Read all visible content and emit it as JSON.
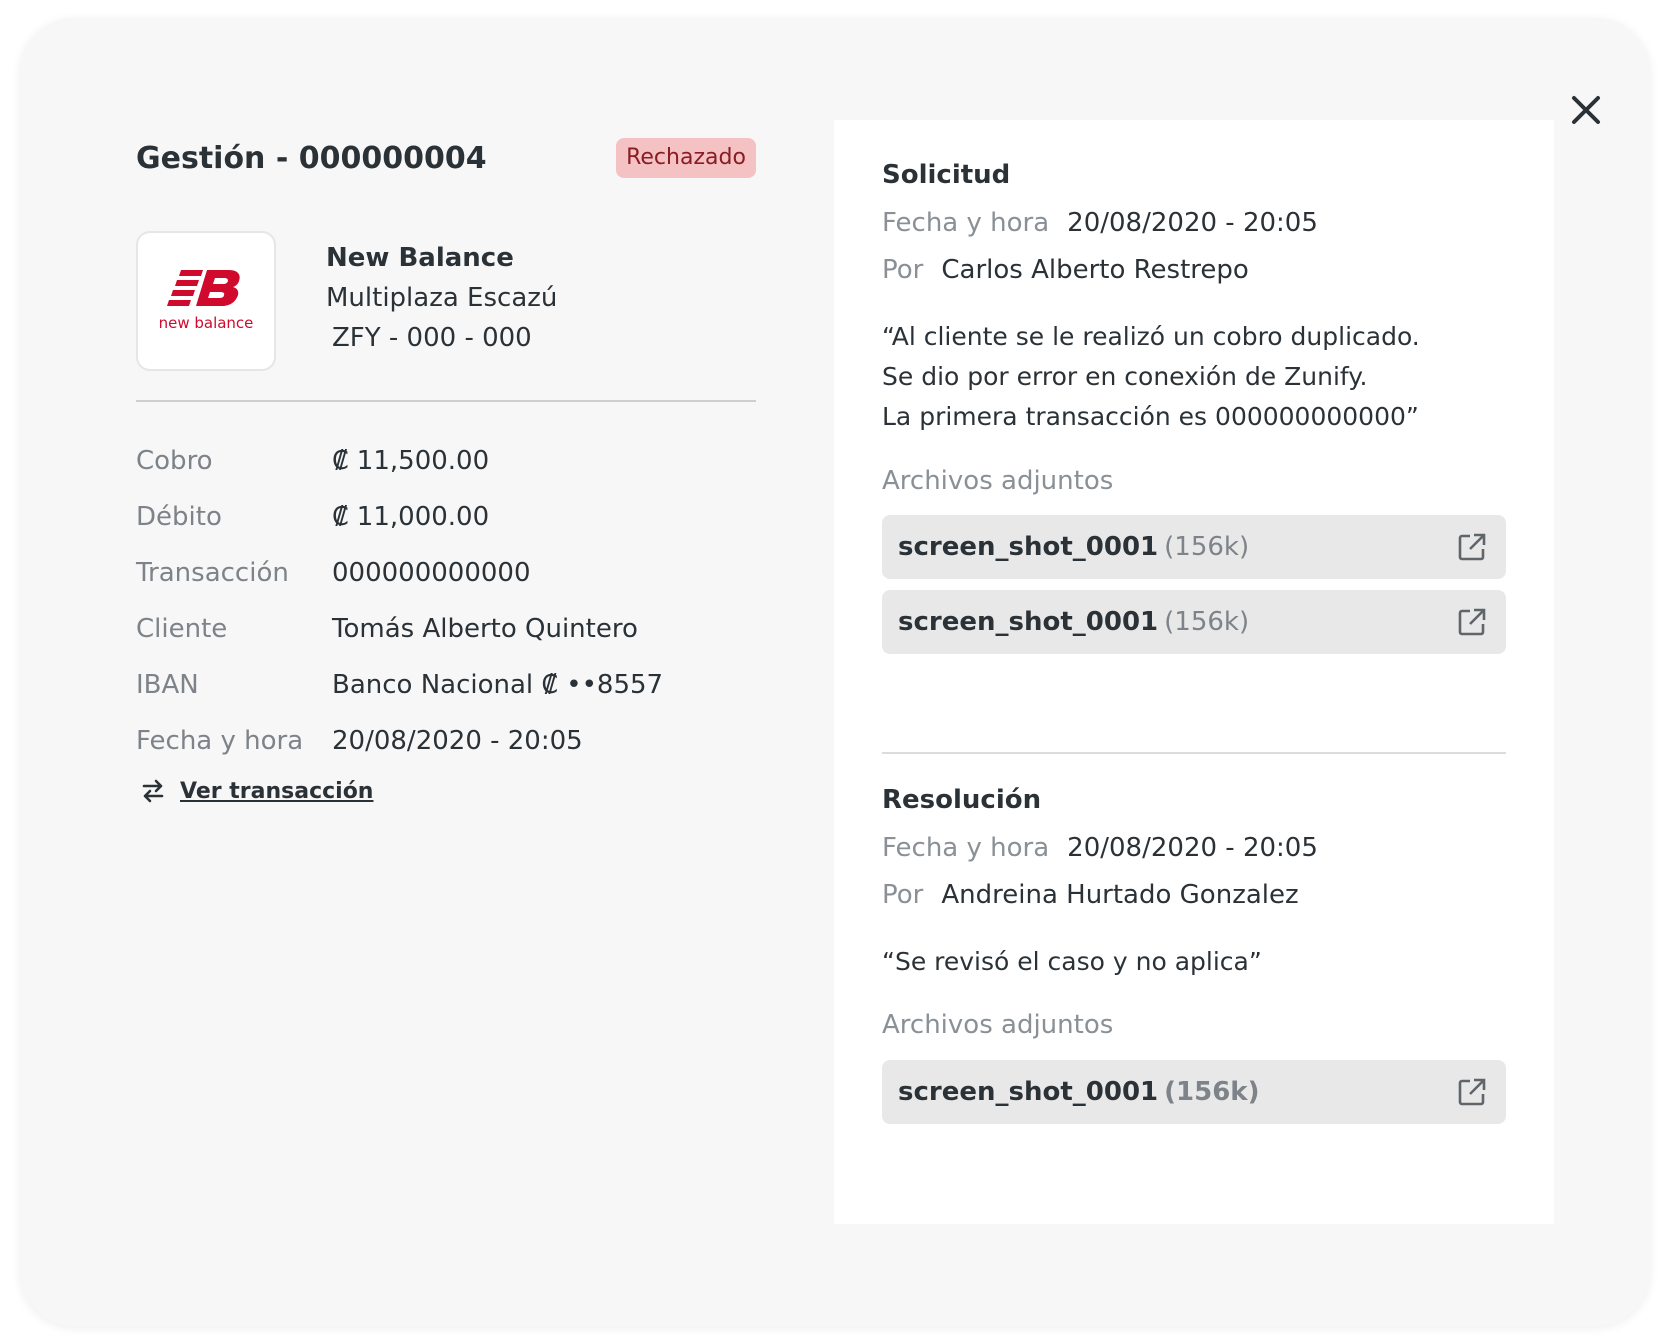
{
  "header": {
    "title": "Gestión - 000000004",
    "status": "Rechazado"
  },
  "merchant": {
    "logo_text": "new balance",
    "name": "New Balance",
    "location": "Multiplaza Escazú",
    "code": "ZFY - 000 - 000"
  },
  "details": [
    {
      "label": "Cobro",
      "value": "₡ 11,500.00"
    },
    {
      "label": "Débito",
      "value": "₡ 11,000.00"
    },
    {
      "label": "Transacción",
      "value": "000000000000"
    },
    {
      "label": "Cliente",
      "value": "Tomás Alberto Quintero"
    },
    {
      "label": "IBAN",
      "value": "Banco Nacional ₡  ••8557"
    },
    {
      "label": "Fecha y hora",
      "value": "20/08/2020 - 20:05"
    }
  ],
  "ver_transaccion_label": "Ver transacción",
  "solicitud": {
    "title": "Solicitud",
    "fecha_label": "Fecha y hora",
    "fecha_value": "20/08/2020 - 20:05",
    "por_label": "Por",
    "por_value": "Carlos Alberto Restrepo",
    "quote_lines": [
      "“Al cliente se le realizó un cobro duplicado.",
      "Se dio por error en conexión de Zunify.",
      "La primera transacción es 000000000000”"
    ],
    "attachments_label": "Archivos adjuntos",
    "attachments": [
      {
        "name": "screen_shot_0001",
        "size": "(156k)"
      },
      {
        "name": "screen_shot_0001",
        "size": "(156k)"
      }
    ]
  },
  "resolucion": {
    "title": "Resolución",
    "fecha_label": "Fecha y hora",
    "fecha_value": "20/08/2020 - 20:05",
    "por_label": "Por",
    "por_value": "Andreina Hurtado Gonzalez",
    "quote": "“Se revisó el caso y no aplica”",
    "attachments_label": "Archivos adjuntos",
    "attachments": [
      {
        "name": "screen_shot_0001",
        "size": "(156k)"
      }
    ]
  },
  "colors": {
    "badge_bg": "#f5c2c4",
    "badge_text": "#8a1c23",
    "brand_red": "#cf0a2c"
  }
}
